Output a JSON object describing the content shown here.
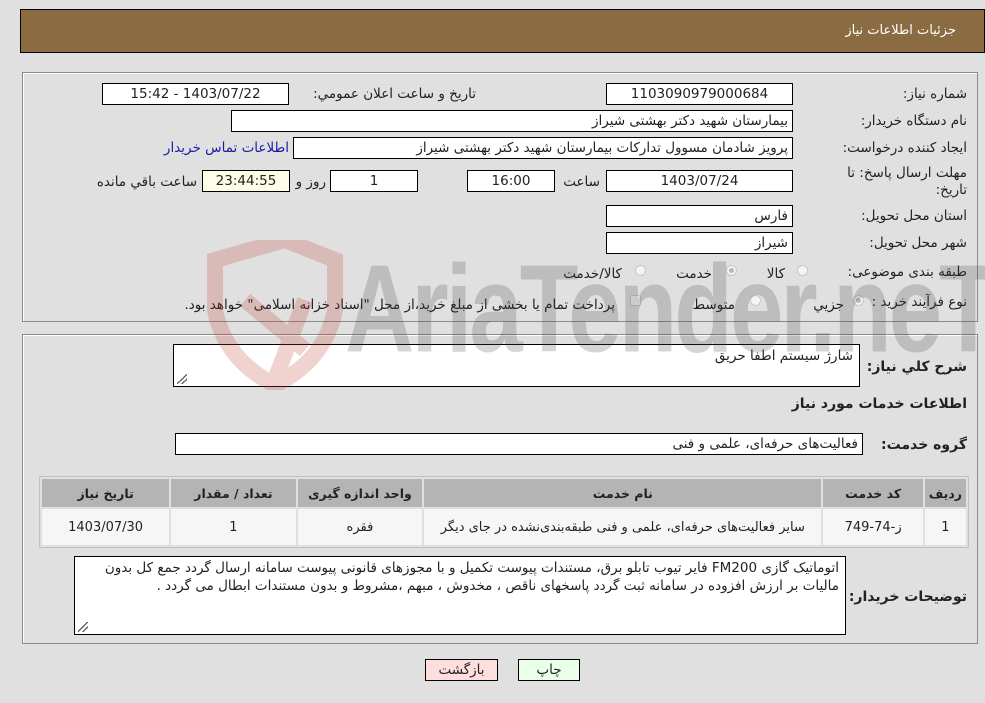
{
  "header": {
    "title": "جزئیات اطلاعات نیاز"
  },
  "need_info": {
    "need_number": {
      "label": "شماره نیاز:",
      "value": "1103090979000684"
    },
    "announce_datetime": {
      "label": "تاريخ و ساعت اعلان عمومي:",
      "value": "1403/07/22 - 15:42"
    },
    "buyer_org": {
      "label": "نام دستگاه خريدار:",
      "value": "بیمارستان شهید دکتر بهشتی شیراز"
    },
    "requester": {
      "label": "ايجاد کننده درخواست:",
      "value": "پرویز شادمان مسوول تدارکات بیمارستان شهید دکتر بهشتی شیراز",
      "contact_link": "اطلاعات تماس خريدار"
    },
    "deadline": {
      "label_line1": "مهلت ارسال پاسخ: تا",
      "label_line2": "تاريخ:",
      "date": "1403/07/24",
      "time_label": "ساعت",
      "time": "16:00",
      "days": "1",
      "days_label": "روز و",
      "remaining": "23:44:55",
      "remaining_label": "ساعت باقي مانده"
    },
    "province": {
      "label": "استان محل تحويل:",
      "value": "فارس"
    },
    "city": {
      "label": "شهر محل تحويل:",
      "value": "شیراز"
    },
    "category": {
      "label": "طبقه بندی موضوعی:",
      "options": [
        {
          "label": "کالا",
          "checked": false
        },
        {
          "label": "خدمت",
          "checked": true
        },
        {
          "label": "کالا/خدمت",
          "checked": false
        }
      ]
    },
    "purchase_type": {
      "label": "نوع فرآيند خريد :",
      "options": [
        {
          "label": "جزيي",
          "checked": true
        },
        {
          "label": "متوسط",
          "checked": false
        }
      ],
      "treasury_note": "پرداخت تمام یا بخشی از مبلغ خرید،از محل \"اسناد خزانه اسلامی\" خواهد بود."
    }
  },
  "details": {
    "description_label": "شرح کلي نياز:",
    "description": "شارژ سیستم اطفا حریق",
    "services_heading": "اطلاعات خدمات مورد نياز",
    "service_group_label": "گروه خدمت:",
    "service_group": "فعالیت‌های حرفه‌ای، علمی و فنی",
    "table": {
      "headers": [
        "رديف",
        "کد خدمت",
        "نام خدمت",
        "واحد اندازه گيری",
        "تعداد / مقدار",
        "تاريخ نياز"
      ],
      "rows": [
        [
          "1",
          "ز-74-749",
          "سایر فعالیت‌های حرفه‌ای، علمی و فنی طبقه‌بندی‌نشده در جای دیگر",
          "فقره",
          "1",
          "1403/07/30"
        ]
      ]
    },
    "buyer_notes_label": "توضيحات خريدار:",
    "buyer_notes": "اتوماتیک گازی FM200 فایر تیوب تابلو برق، مستندات پیوست تکمیل و با مجوزهای قانونی پیوست سامانه ارسال گردد جمع کل بدون مالیات بر ارزش افزوده در سامانه ثبت گردد پاسخهای ناقص ، مخدوش ، مبهم ،مشروط و بدون مستندات ابطال می گردد ."
  },
  "buttons": {
    "print": "چاپ",
    "back": "بازگشت"
  },
  "watermark": {
    "text": "AriaTender.neT"
  },
  "colors": {
    "header_bg": "#8b6b42",
    "print_bg": "#eaffea",
    "back_bg": "#ffdede",
    "link": "#1a1aa8"
  }
}
